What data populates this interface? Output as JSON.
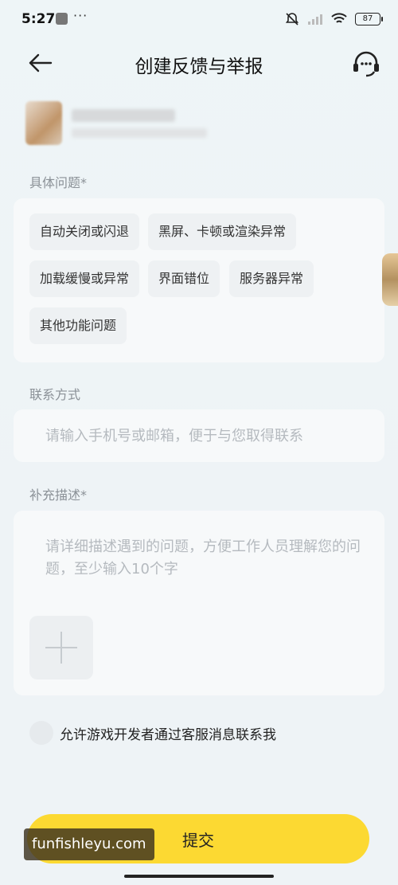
{
  "status_bar": {
    "time": "5:27",
    "dots": "···",
    "battery": "87"
  },
  "header": {
    "title": "创建反馈与举报"
  },
  "specific_issue": {
    "label": "具体问题*",
    "options": [
      "自动关闭或闪退",
      "黑屏、卡顿或渲染异常",
      "加载缓慢或异常",
      "界面错位",
      "服务器异常",
      "其他功能问题"
    ]
  },
  "contact": {
    "label": "联系方式",
    "placeholder": "请输入手机号或邮箱，便于与您取得联系"
  },
  "description": {
    "label": "补充描述*",
    "placeholder": "请详细描述遇到的问题，方便工作人员理解您的问题，至少输入10个字"
  },
  "consent": {
    "text": "允许游戏开发者通过客服消息联系我"
  },
  "submit": {
    "label": "提交"
  },
  "watermark": {
    "text": "funfishleyu.com"
  },
  "icons": {
    "back": "back-arrow-icon",
    "support": "customer-service-icon",
    "add": "add-image-icon"
  }
}
